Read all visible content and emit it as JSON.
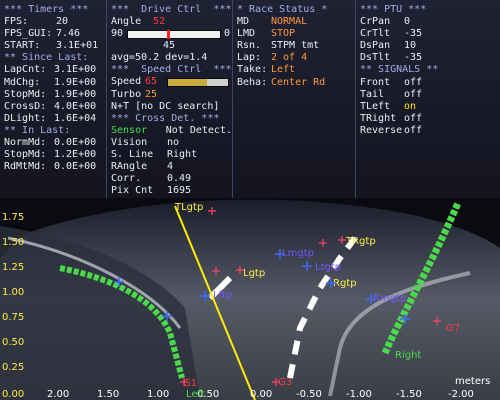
{
  "timers": {
    "header": "*** Timers ***",
    "rows": [
      {
        "label": "FPS:",
        "value": "20"
      },
      {
        "label": "FPS_GUI:",
        "value": "7.46"
      },
      {
        "label": "START:",
        "value": "3.1E+01"
      }
    ],
    "since_header": "** Since Last:",
    "since_rows": [
      {
        "label": "LapCnt:",
        "value": "3.1E+00"
      },
      {
        "label": "MdChg:",
        "value": "1.9E+00"
      },
      {
        "label": "StopMd:",
        "value": "1.9E+00"
      },
      {
        "label": "CrossD:",
        "value": "4.0E+00"
      },
      {
        "label": "DLight:",
        "value": "1.6E+04"
      }
    ],
    "inlast_header": "** In Last:",
    "inlast_rows": [
      {
        "label": "NormMd:",
        "value": "0.0E+00"
      },
      {
        "label": "StopMd:",
        "value": "1.2E+00"
      },
      {
        "label": "RdMtMd:",
        "value": "0.0E+00"
      }
    ]
  },
  "drive": {
    "header": "***  Drive Ctrl  ***",
    "angle_label": "Angle",
    "angle_value": "52",
    "scale_min": "90",
    "scale_max": "0",
    "angle_fraction": 0.42,
    "center_value": "45",
    "avg_text": "avg=50.2 dev=1.4",
    "speed_header": "***  Speed Ctrl  ***",
    "speed_label": "Speed",
    "speed_value": "65",
    "speed_fraction": 0.65,
    "turbo_label": "Turbo",
    "turbo_value": "25",
    "search_text": "N+T [no DC search]",
    "cross_header": "*** Cross Det. ***",
    "cross_rows": [
      {
        "label": "Sensor",
        "value": "Not Detect."
      },
      {
        "label": "Vision",
        "value": "no"
      },
      {
        "label": "S. Line",
        "value": "Right"
      },
      {
        "label": "RAngle",
        "value": "4"
      },
      {
        "label": "Corr.",
        "value": "0.49"
      },
      {
        "label": "Pix Cnt",
        "value": "1695"
      }
    ]
  },
  "race": {
    "header": "* Race Status *",
    "rows": [
      {
        "label": "MD",
        "value": "NORMAL"
      },
      {
        "label": "LMD",
        "value": "STOP"
      },
      {
        "label": "Rsn.",
        "value": "STPM tmt"
      },
      {
        "label": "Lap:",
        "value": "2 of 4"
      },
      {
        "label": "Take:",
        "value": "Left"
      },
      {
        "label": "Beha:",
        "value": "Center Rd"
      }
    ]
  },
  "ptu": {
    "header": "*** PTU ***",
    "rows": [
      {
        "label": "CrPan",
        "value": "0"
      },
      {
        "label": "CrTlt",
        "value": "-35"
      },
      {
        "label": "DsPan",
        "value": "10"
      },
      {
        "label": "DsTlt",
        "value": "-35"
      }
    ],
    "signals_header": "** SIGNALS **",
    "signals": [
      {
        "label": "Front",
        "value": "off"
      },
      {
        "label": "Tail",
        "value": "off"
      },
      {
        "label": "TLeft",
        "value": "on"
      },
      {
        "label": "TRight",
        "value": "off"
      },
      {
        "label": "Reverse",
        "value": "off"
      }
    ]
  },
  "camera": {
    "y_ticks": [
      "1.75",
      "1.50",
      "1.25",
      "1.00",
      "0.75",
      "0.50",
      "0.25",
      "0.00"
    ],
    "x_ticks": [
      "2.00",
      "1.50",
      "1.00",
      "0.50",
      "0.00",
      "-0.50",
      "-1.00",
      "-1.50",
      "-2.00"
    ],
    "unit": "meters",
    "labels": {
      "tlgtp": "TLgtp",
      "lgtp": "Lgtp",
      "lmgtp": "Lmgtp",
      "lftp": "Lftp",
      "ltgtp": "Ltgtp",
      "rgtp": "Rgtp",
      "trgtp": "TRgtp",
      "right_side": "Rmgtp",
      "left": "Left",
      "right": "Right",
      "g1": "G1",
      "g2": "G3",
      "g3": "G7"
    }
  },
  "colors": {
    "accent_red": "#ff3b3b",
    "accent_orange": "#ff9a3a",
    "accent_green": "#3fe04a",
    "accent_yellow": "#ffe21e",
    "header_blue": "#9fb0e8"
  }
}
